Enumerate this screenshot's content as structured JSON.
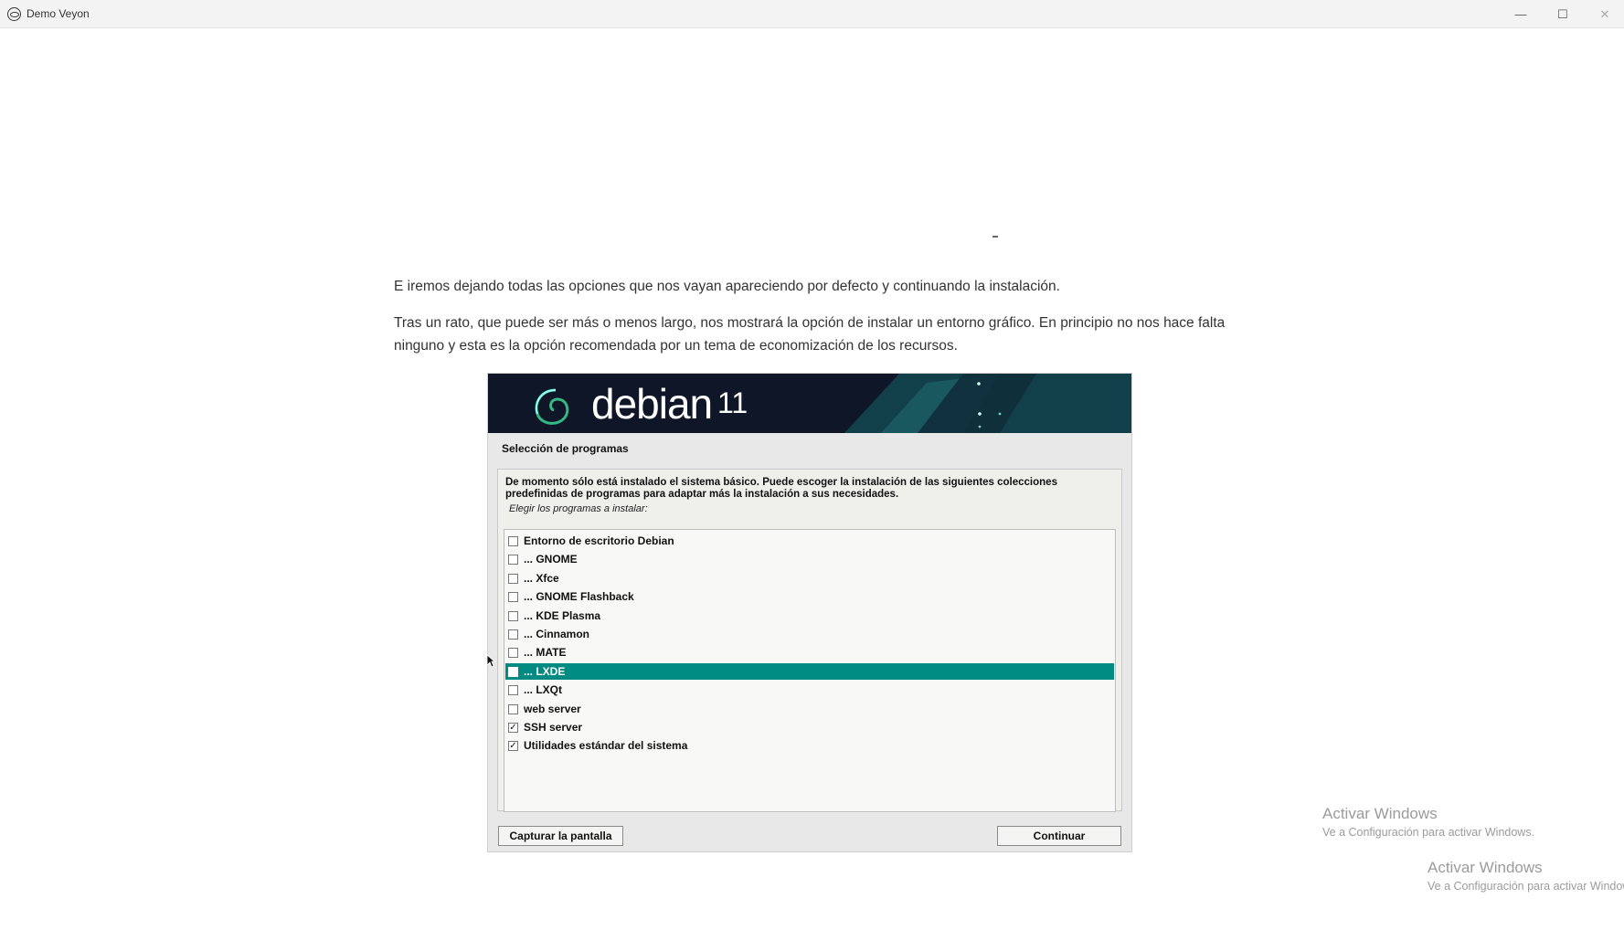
{
  "window": {
    "title": "Demo Veyon",
    "minimize_glyph": "—",
    "maximize_glyph": "☐",
    "close_glyph": "✕"
  },
  "article": {
    "separator": "-",
    "paragraph1": "E iremos dejando todas las opciones que nos vayan apareciendo por defecto y continuando la instalación.",
    "paragraph2": "Tras un rato, que puede ser más o menos largo, nos mostrará la opción de instalar un entorno gráfico. En principio no nos hace falta ninguno y esta es la opción recomendada por un tema de economización de los recursos."
  },
  "installer": {
    "brand": "debian",
    "version": "11",
    "section_title": "Selección de programas",
    "description": "De momento sólo está instalado el sistema básico. Puede escoger la instalación de las siguientes colecciones predefinidas de programas para adaptar más la instalación a sus necesidades.",
    "prompt": "Elegir los programas a instalar:",
    "options": [
      {
        "label": "Entorno de escritorio Debian",
        "checked": false,
        "selected": false
      },
      {
        "label": "... GNOME",
        "checked": false,
        "selected": false
      },
      {
        "label": "... Xfce",
        "checked": false,
        "selected": false
      },
      {
        "label": "... GNOME Flashback",
        "checked": false,
        "selected": false
      },
      {
        "label": "... KDE Plasma",
        "checked": false,
        "selected": false
      },
      {
        "label": "... Cinnamon",
        "checked": false,
        "selected": false
      },
      {
        "label": "... MATE",
        "checked": false,
        "selected": false
      },
      {
        "label": "... LXDE",
        "checked": false,
        "selected": true
      },
      {
        "label": "... LXQt",
        "checked": false,
        "selected": false
      },
      {
        "label": "web server",
        "checked": false,
        "selected": false
      },
      {
        "label": "SSH server",
        "checked": true,
        "selected": false
      },
      {
        "label": "Utilidades estándar del sistema",
        "checked": true,
        "selected": false
      }
    ],
    "capture_button": "Capturar la pantalla",
    "continue_button": "Continuar",
    "accent_color": "#008b82",
    "banner_color": "#0f1628"
  },
  "watermarks": [
    {
      "heading": "Activar Windows",
      "subtext": "Ve a Configuración para activar Windows."
    },
    {
      "heading": "Activar Windows",
      "subtext": "Ve a Configuración para activar Windows."
    }
  ]
}
